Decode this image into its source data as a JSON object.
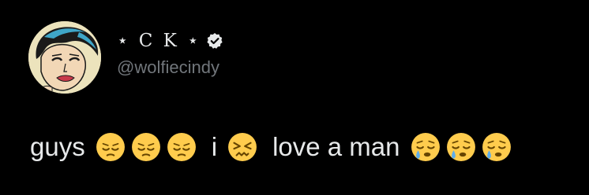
{
  "profile": {
    "display_name": "⋆ C K ⋆",
    "handle": "@wolfiecindy",
    "verified": true,
    "avatar_icon": "avatar-illustration-icon"
  },
  "tweet": {
    "segments": [
      {
        "type": "text",
        "text": "guys"
      },
      {
        "type": "emoji",
        "name": "pensive-face-icon",
        "count": 3
      },
      {
        "type": "text",
        "text": "i"
      },
      {
        "type": "emoji",
        "name": "confounded-face-icon",
        "count": 1
      },
      {
        "type": "text",
        "text": "love a man"
      },
      {
        "type": "emoji",
        "name": "sleepy-face-icon",
        "count": 3
      }
    ],
    "word_1": "guys",
    "word_2": "i",
    "word_3": "love a man"
  },
  "colors": {
    "background": "#000000",
    "text_primary": "#e7e9ea",
    "text_secondary": "#71767b",
    "emoji_yellow": "#ffcc4d",
    "tear_blue": "#5dadec"
  }
}
